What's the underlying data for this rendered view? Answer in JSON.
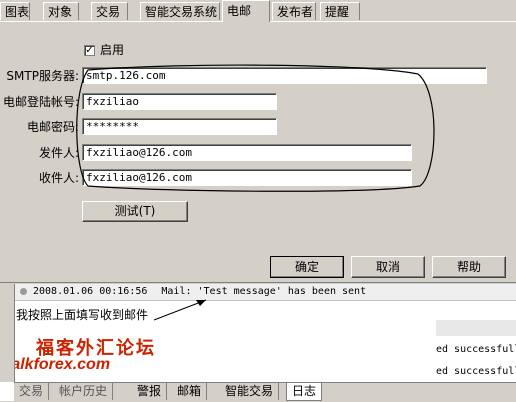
{
  "top_tabs": [
    "图表",
    "对象",
    "交易",
    "智能交易系统",
    "电邮",
    "发布者",
    "提醒"
  ],
  "email_settings": {
    "enable_label": "启用",
    "enabled": true,
    "smtp_server_label": "SMTP服务器:",
    "smtp_server_value": "smtp.126.com",
    "login_label": "电邮登陆帐号:",
    "login_value": "fxziliao",
    "password_label": "电邮密码:",
    "password_value": "********",
    "from_label": "发件人:",
    "from_value": "fxziliao@126.com",
    "to_label": "收件人:",
    "to_value": "fxziliao@126.com",
    "test_button": "测试(T)"
  },
  "dialog_buttons": {
    "ok": "确定",
    "cancel": "取消",
    "help": "帮助"
  },
  "journal": {
    "first_entry_time": "2008.01.06 00:16:56",
    "first_entry_message": "Mail: 'Test message' has been sent",
    "annotation": "我按照上面填写收到邮件",
    "partial_line_1": "ed successfull",
    "partial_line_2": "ed successfull"
  },
  "watermark": {
    "chinese": "福客外汇论坛",
    "latin": "talkforex.com"
  },
  "bottom_tabs": [
    "交易",
    "帐户历史",
    "警报",
    "邮箱",
    "智能交易",
    "日志"
  ],
  "colors": {
    "dialog_bg": "#d4d0c8",
    "watermark_red": "#cc2200",
    "circle_stroke": "#000000"
  }
}
